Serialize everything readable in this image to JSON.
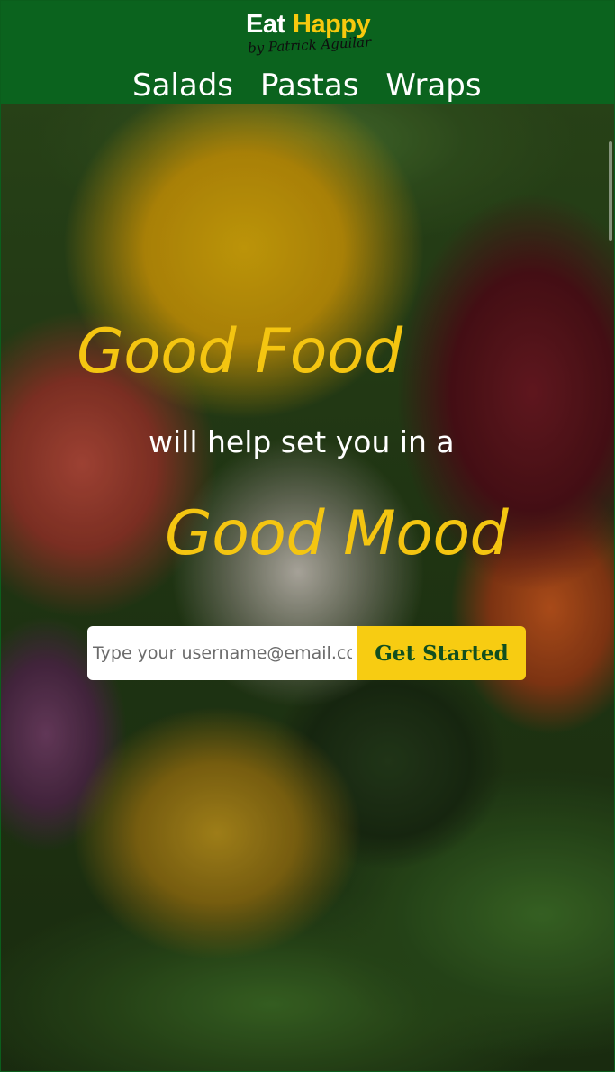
{
  "brand": {
    "word_1": "Eat",
    "word_2": "Happy",
    "byline": "by Patrick Aguilar",
    "colors": {
      "header_bg": "#0b631e",
      "accent": "#f4c511",
      "cta_text": "#114f1f"
    }
  },
  "nav": {
    "items": [
      {
        "label": "Salads"
      },
      {
        "label": "Pastas"
      },
      {
        "label": "Wraps"
      }
    ]
  },
  "hero": {
    "headline_1": "Good Food",
    "subline": "will help set you in a",
    "headline_2": "Good Mood"
  },
  "signup": {
    "placeholder": "Type your username@email.com",
    "button_label": "Get Started"
  }
}
